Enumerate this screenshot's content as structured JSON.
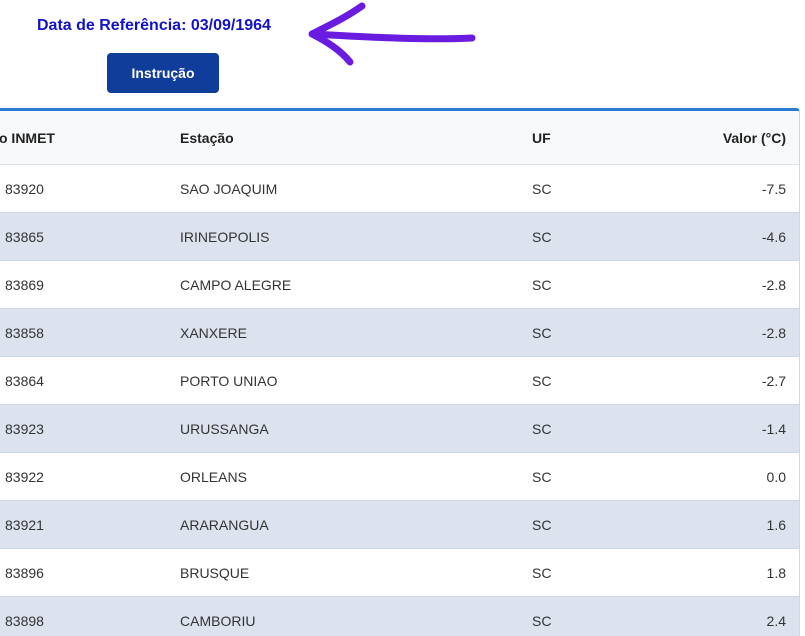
{
  "header": {
    "reference_date": "Data de Referência: 03/09/1964",
    "instruction_button": "Instrução"
  },
  "annotation": {
    "arrow_color": "#6a1be0"
  },
  "colors": {
    "title": "#1212c8",
    "button_bg": "#0f3d99",
    "table_top_border": "#2a7ad1",
    "row_alt_bg": "#dce3ef"
  },
  "table": {
    "columns": [
      "digo INMET",
      "Estação",
      "UF",
      "Valor (°C)"
    ],
    "rows": [
      {
        "code": "83920",
        "station": "SAO JOAQUIM",
        "uf": "SC",
        "value": "-7.5"
      },
      {
        "code": "83865",
        "station": "IRINEOPOLIS",
        "uf": "SC",
        "value": "-4.6"
      },
      {
        "code": "83869",
        "station": "CAMPO ALEGRE",
        "uf": "SC",
        "value": "-2.8"
      },
      {
        "code": "83858",
        "station": "XANXERE",
        "uf": "SC",
        "value": "-2.8"
      },
      {
        "code": "83864",
        "station": "PORTO UNIAO",
        "uf": "SC",
        "value": "-2.7"
      },
      {
        "code": "83923",
        "station": "URUSSANGA",
        "uf": "SC",
        "value": "-1.4"
      },
      {
        "code": "83922",
        "station": "ORLEANS",
        "uf": "SC",
        "value": "0.0"
      },
      {
        "code": "83921",
        "station": "ARARANGUA",
        "uf": "SC",
        "value": "1.6"
      },
      {
        "code": "83896",
        "station": "BRUSQUE",
        "uf": "SC",
        "value": "1.8"
      },
      {
        "code": "83898",
        "station": "CAMBORIU",
        "uf": "SC",
        "value": "2.4"
      }
    ]
  }
}
